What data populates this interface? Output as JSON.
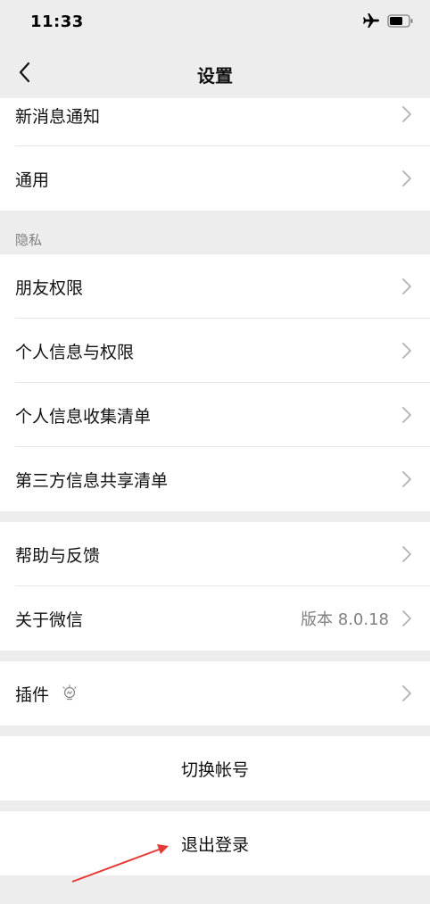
{
  "status_bar": {
    "time": "11:33",
    "airplane_icon": "airplane-icon",
    "battery_icon": "battery-icon"
  },
  "nav": {
    "title": "设置",
    "back_icon": "chevron-left-icon"
  },
  "rows": {
    "notifications": "新消息通知",
    "general": "通用",
    "privacy_header": "隐私",
    "friend_permissions": "朋友权限",
    "personal_info_permissions": "个人信息与权限",
    "personal_info_collection": "个人信息收集清单",
    "third_party_sharing": "第三方信息共享清单",
    "help_feedback": "帮助与反馈",
    "about": "关于微信",
    "about_version": "版本 8.0.18",
    "plugins": "插件"
  },
  "actions": {
    "switch_account": "切换帐号",
    "logout": "退出登录"
  },
  "colors": {
    "background": "#ededed",
    "cell": "#ffffff",
    "arrow": "#e53935"
  }
}
